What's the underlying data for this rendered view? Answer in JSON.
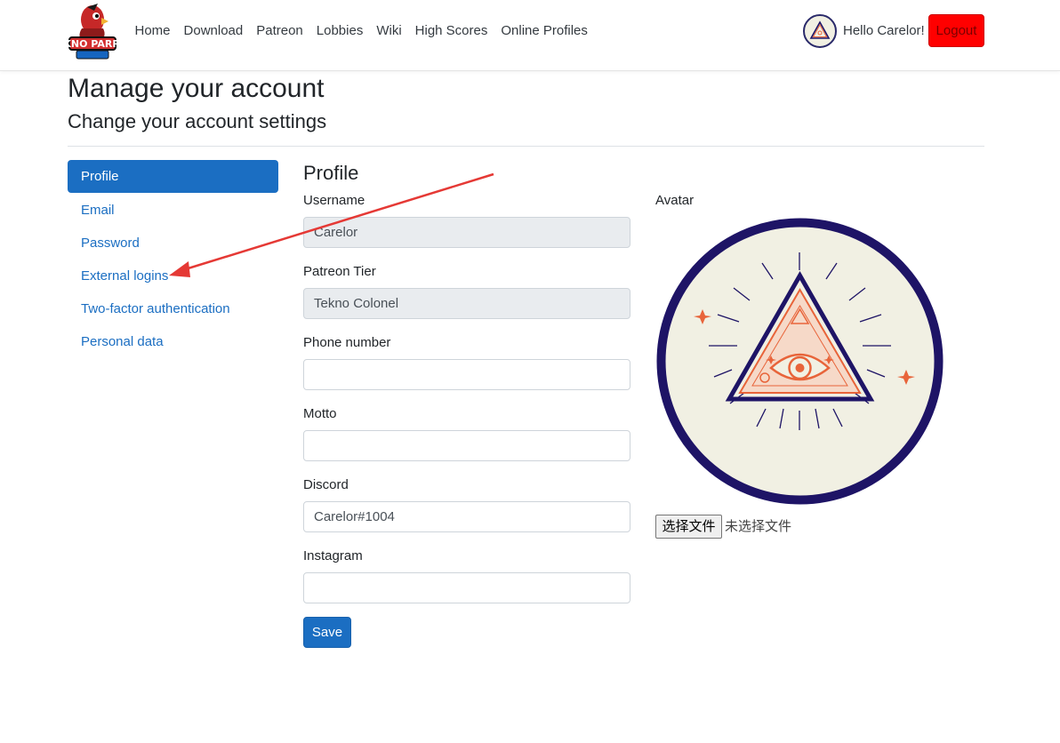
{
  "nav": {
    "logo_text": "TEKNO PARROT",
    "links": [
      "Home",
      "Download",
      "Patreon",
      "Lobbies",
      "Wiki",
      "High Scores",
      "Online Profiles"
    ],
    "greeting": "Hello Carelor!",
    "logout_label": "Logout"
  },
  "page": {
    "title": "Manage your account",
    "subtitle": "Change your account settings"
  },
  "sidebar": {
    "items": [
      {
        "label": "Profile",
        "active": true
      },
      {
        "label": "Email",
        "active": false
      },
      {
        "label": "Password",
        "active": false
      },
      {
        "label": "External logins",
        "active": false
      },
      {
        "label": "Two-factor authentication",
        "active": false
      },
      {
        "label": "Personal data",
        "active": false
      }
    ]
  },
  "profile": {
    "title": "Profile",
    "fields": [
      {
        "label": "Username",
        "value": "Carelor",
        "readonly": true
      },
      {
        "label": "Patreon Tier",
        "value": "Tekno Colonel",
        "readonly": true
      },
      {
        "label": "Phone number",
        "value": "",
        "readonly": false
      },
      {
        "label": "Motto",
        "value": "",
        "readonly": false
      },
      {
        "label": "Discord",
        "value": "Carelor#1004",
        "readonly": false
      },
      {
        "label": "Instagram",
        "value": "",
        "readonly": false
      }
    ],
    "save_label": "Save"
  },
  "avatar": {
    "label": "Avatar",
    "file_button": "选择文件",
    "file_status": "未选择文件",
    "image_icon": "all-seeing-eye-triangle-icon"
  },
  "colors": {
    "primary": "#1b6ec2",
    "logout": "#ff0000",
    "avatar_ring": "#1e1466",
    "avatar_bg": "#f1f0e3",
    "avatar_accent": "#e8643a",
    "annotation_arrow": "#e53935"
  }
}
